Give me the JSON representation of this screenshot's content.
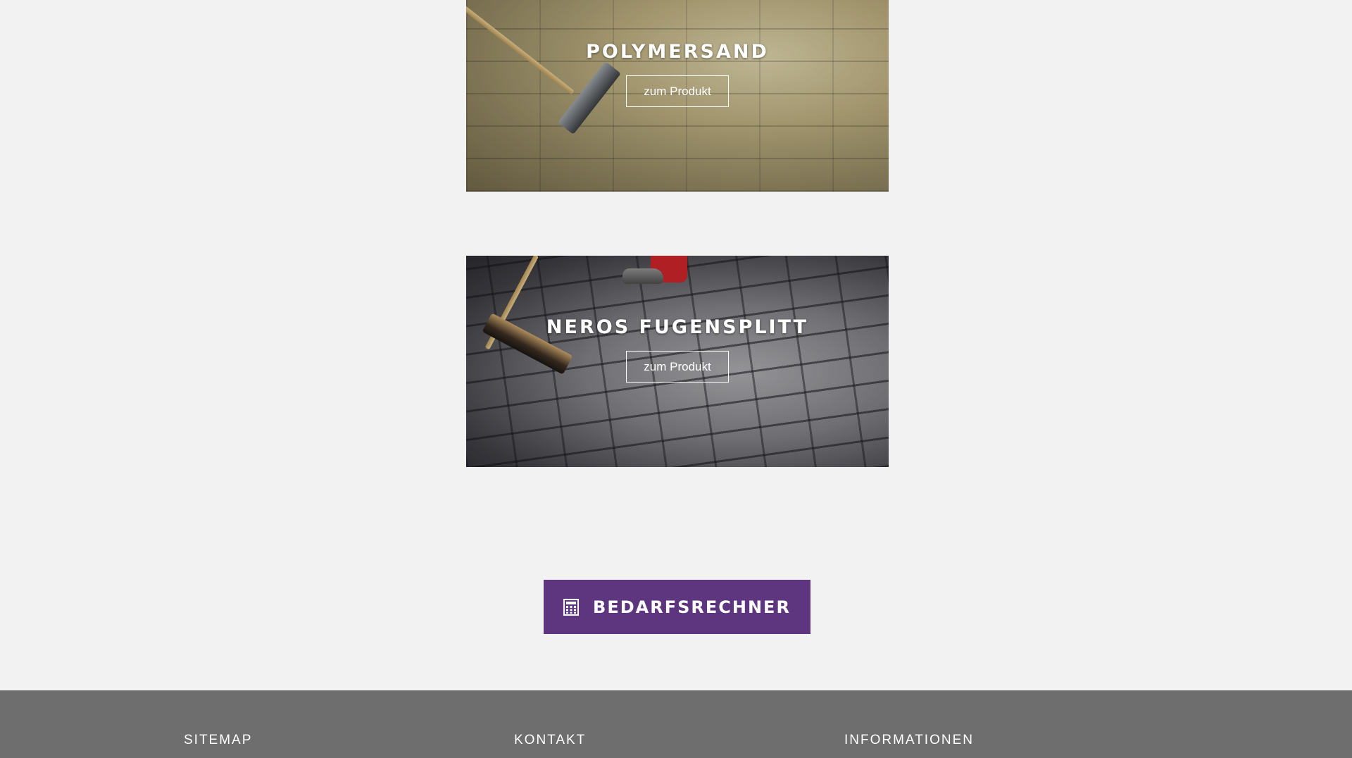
{
  "products": [
    {
      "title": "POLYMERSAND",
      "link_label": "zum Produkt"
    },
    {
      "title": "NEROS FUGENSPLITT",
      "link_label": "zum Produkt"
    }
  ],
  "calculator_button": {
    "label": "BEDARFSRECHNER",
    "icon": "calculator-icon",
    "color": "#5e3680"
  },
  "footer": {
    "background": "#6e6e6e",
    "columns": [
      "SITEMAP",
      "KONTAKT",
      "INFORMATIONEN"
    ]
  }
}
